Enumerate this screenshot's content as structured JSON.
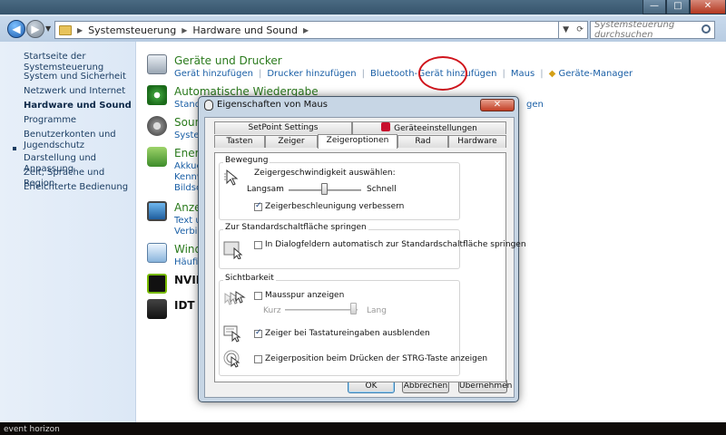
{
  "desktop": {
    "label": "event horizon"
  },
  "explorer": {
    "breadcrumb": [
      "Systemsteuerung",
      "Hardware und Sound"
    ],
    "search_placeholder": "Systemsteuerung durchsuchen",
    "controls": {
      "minimize": "—",
      "maximize": "□",
      "close": "✕"
    }
  },
  "sidebar": {
    "items": [
      "Startseite der Systemsteuerung",
      "System und Sicherheit",
      "Netzwerk und Internet",
      "Hardware und Sound",
      "Programme",
      "Benutzerkonten und",
      "Jugendschutz",
      "Darstellung und Anpassung",
      "Zeit, Sprache und Region",
      "Erleichterte Bedienung"
    ]
  },
  "categories": {
    "devices": {
      "title": "Geräte und Drucker",
      "links": [
        "Gerät hinzufügen",
        "Drucker hinzufügen",
        "Bluetooth-Gerät hinzufügen",
        "Maus",
        "Geräte-Manager"
      ]
    },
    "autoplay": {
      "title": "Automatische Wiedergabe",
      "partial": "Standa",
      "partial_right": "gen"
    },
    "sound": {
      "title": "Sound",
      "partial": "System"
    },
    "energy": {
      "title": "Energ",
      "lines": [
        "Akkuei",
        "Kennwo",
        "Bildsch"
      ]
    },
    "display": {
      "title": "Anzei",
      "lines": [
        "Text un",
        "Verbind"
      ]
    },
    "windows": {
      "title": "Windo",
      "lines": [
        "Häufig"
      ]
    },
    "nvidia": {
      "title": "NVIDI"
    },
    "idt": {
      "title": "IDT A"
    }
  },
  "dialog": {
    "title": "Eigenschaften von Maus",
    "tabs_row1": [
      "SetPoint Settings",
      "Geräteeinstellungen"
    ],
    "tabs_row2": [
      "Tasten",
      "Zeiger",
      "Zeigeroptionen",
      "Rad",
      "Hardware"
    ],
    "movement": {
      "label": "Bewegung",
      "speed_label": "Zeigergeschwindigkeit auswählen:",
      "slow": "Langsam",
      "fast": "Schnell",
      "speed_value": 0.5,
      "accel_label": "Zeigerbeschleunigung verbessern",
      "accel_checked": true
    },
    "snap": {
      "label": "Zur Standardschaltfläche springen",
      "option": "In Dialogfeldern automatisch zur Standardschaltfläche springen",
      "checked": false
    },
    "visibility": {
      "label": "Sichtbarkeit",
      "trail_label": "Mausspur anzeigen",
      "trail_checked": false,
      "short": "Kurz",
      "long": "Lang",
      "trail_value": 0.95,
      "hide_label": "Zeiger bei Tastatureingaben ausblenden",
      "hide_checked": true,
      "ctrl_label": "Zeigerposition beim Drücken der STRG-Taste anzeigen",
      "ctrl_checked": false
    },
    "buttons": {
      "ok": "OK",
      "cancel": "Abbrechen",
      "apply": "Übernehmen"
    },
    "close": "✕"
  },
  "colors": {
    "highlight_ellipse": "#d0141c",
    "category_title": "#2a7a1c",
    "link": "#1a5fa6"
  }
}
